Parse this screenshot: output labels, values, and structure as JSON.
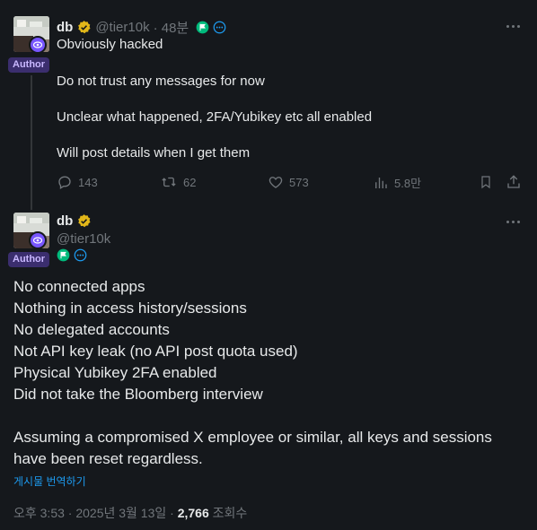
{
  "tweet1": {
    "name": "db",
    "handle": "@tier10k",
    "time": "· 48분",
    "author_badge": "Author",
    "lines": [
      "Obviously hacked",
      "Do not trust any messages for now",
      "Unclear what happened, 2FA/Yubikey etc all enabled",
      "Will post details when I get them"
    ],
    "actions": {
      "replies": "143",
      "reposts": "62",
      "likes": "573",
      "views": "5.8만"
    }
  },
  "tweet2": {
    "name": "db",
    "handle": "@tier10k",
    "author_badge": "Author",
    "lines": [
      "No connected apps",
      "Nothing in access history/sessions",
      "No delegated accounts",
      "Not API key leak (no API post quota used)",
      "Physical Yubikey 2FA enabled",
      "Did not take the Bloomberg interview",
      "",
      "Assuming a compromised X employee or similar, all keys and sessions",
      "have been reset regardless."
    ],
    "translate_link": "게시물 번역하기",
    "timestamp": "오후 3:53 · 2025년 3월 13일 · ",
    "views_count": "2,766",
    "views_label": " 조회수"
  },
  "colors": {
    "background": "#15181c",
    "text": "#e7e9ea",
    "muted": "#71767b",
    "verified_gold": "#e2b719",
    "accent_blue": "#1d9bf0",
    "author_purple": "#7856ff",
    "flag_green": "#00ba7c"
  },
  "icons": [
    "verified-badge-icon",
    "flag-icon",
    "circle-more-icon",
    "more-options-icon",
    "reply-icon",
    "repost-icon",
    "like-icon",
    "views-icon",
    "bookmark-icon",
    "share-icon",
    "eye-icon"
  ]
}
